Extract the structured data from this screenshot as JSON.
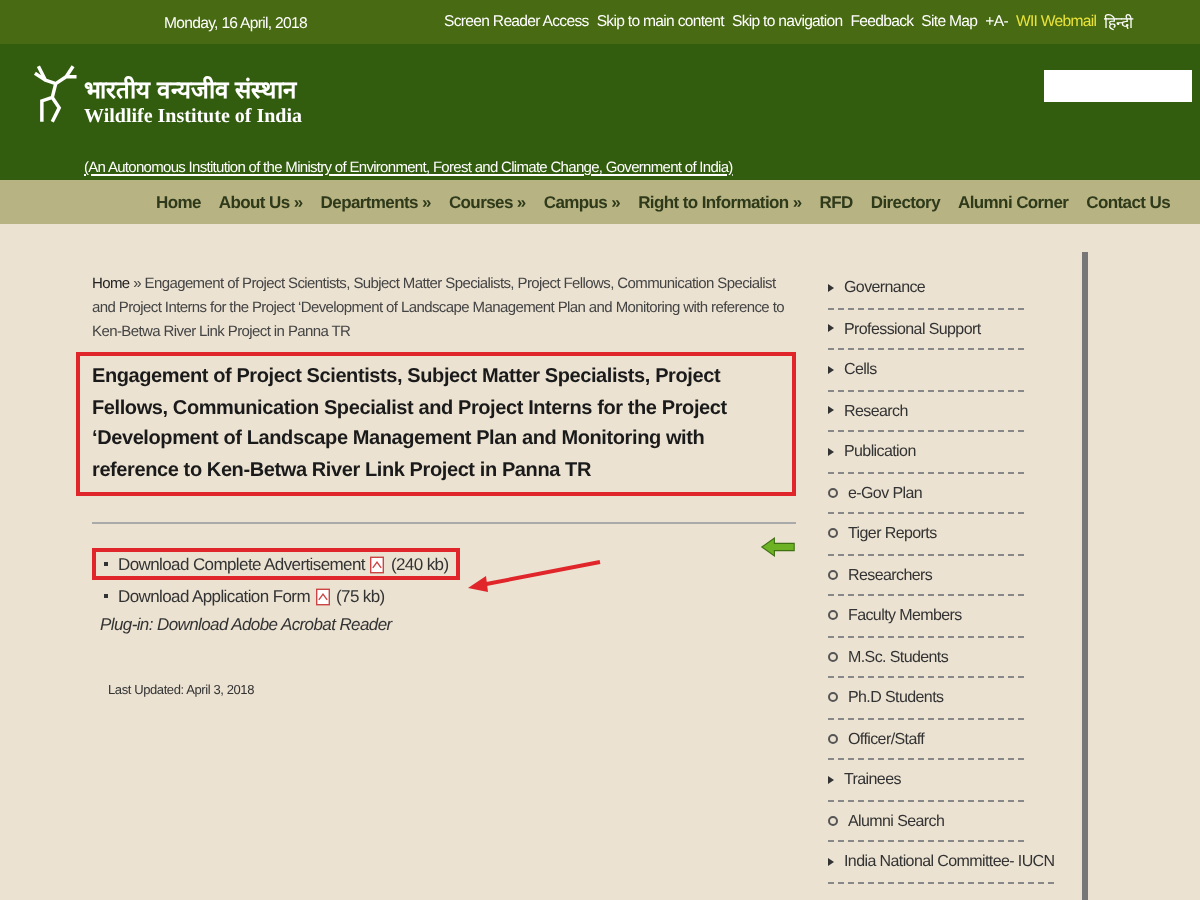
{
  "top_bar": {
    "date": "Monday, 16 April, 2018",
    "links": [
      {
        "label": "Screen Reader Access",
        "kind": "plain"
      },
      {
        "label": "Skip to main content",
        "kind": "plain"
      },
      {
        "label": "Skip to navigation",
        "kind": "plain"
      },
      {
        "label": "Feedback",
        "kind": "plain"
      },
      {
        "label": "Site Map",
        "kind": "plain"
      },
      {
        "label": "+A-",
        "kind": "plain"
      },
      {
        "label": "WII Webmail",
        "kind": "highlight"
      },
      {
        "label": "हिन्दी",
        "kind": "plain"
      }
    ]
  },
  "header": {
    "logo_hindi": "भारतीय वन्यजीव संस्थान",
    "logo_english": "Wildlife Institute of India",
    "tagline": "(An Autonomous Institution of the Ministry of Environment, Forest and Climate Change, Government of India)"
  },
  "nav": [
    "Home",
    "About Us »",
    "Departments »",
    "Courses »",
    "Campus »",
    "Right to Information »",
    "RFD",
    "Directory",
    "Alumni Corner",
    "Contact Us"
  ],
  "breadcrumb": {
    "home": "Home",
    "separator": "»",
    "current": "Engagement of Project Scientists, Subject Matter Specialists, Project Fellows, Communication Specialist and Project Interns for the Project ‘Development of Landscape Management Plan and Monitoring with reference to Ken-Betwa River Link Project in Panna TR"
  },
  "title": "Engagement of Project Scientists, Subject Matter Specialists, Project Fellows, Communication Specialist and Project Interns for the Project ‘Development of Landscape Management Plan and Monitoring with reference to Ken-Betwa River Link Project in Panna TR",
  "downloads": [
    {
      "label": "Download Complete Advertisement",
      "size": "(240 kb)",
      "highlighted": true
    },
    {
      "label": "Download Application Form",
      "size": "(75 kb)",
      "highlighted": false
    }
  ],
  "plugin_note": "Plug-in: Download Adobe Acrobat Reader",
  "last_updated": "Last Updated: April 3, 2018",
  "sidebar": [
    {
      "label": "Governance",
      "kind": "expand"
    },
    {
      "label": "Professional Support",
      "kind": "expand"
    },
    {
      "label": "Cells",
      "kind": "expand"
    },
    {
      "label": "Research",
      "kind": "expand"
    },
    {
      "label": "Publication",
      "kind": "expand"
    },
    {
      "label": "e-Gov Plan",
      "kind": "link"
    },
    {
      "label": "Tiger Reports",
      "kind": "link"
    },
    {
      "label": "Researchers",
      "kind": "link"
    },
    {
      "label": "Faculty Members",
      "kind": "link"
    },
    {
      "label": "M.Sc. Students",
      "kind": "link"
    },
    {
      "label": "Ph.D Students",
      "kind": "link"
    },
    {
      "label": "Officer/Staff",
      "kind": "link"
    },
    {
      "label": "Trainees",
      "kind": "expand"
    },
    {
      "label": "Alumni Search",
      "kind": "link"
    },
    {
      "label": "India National Committee- IUCN",
      "kind": "expand"
    }
  ]
}
